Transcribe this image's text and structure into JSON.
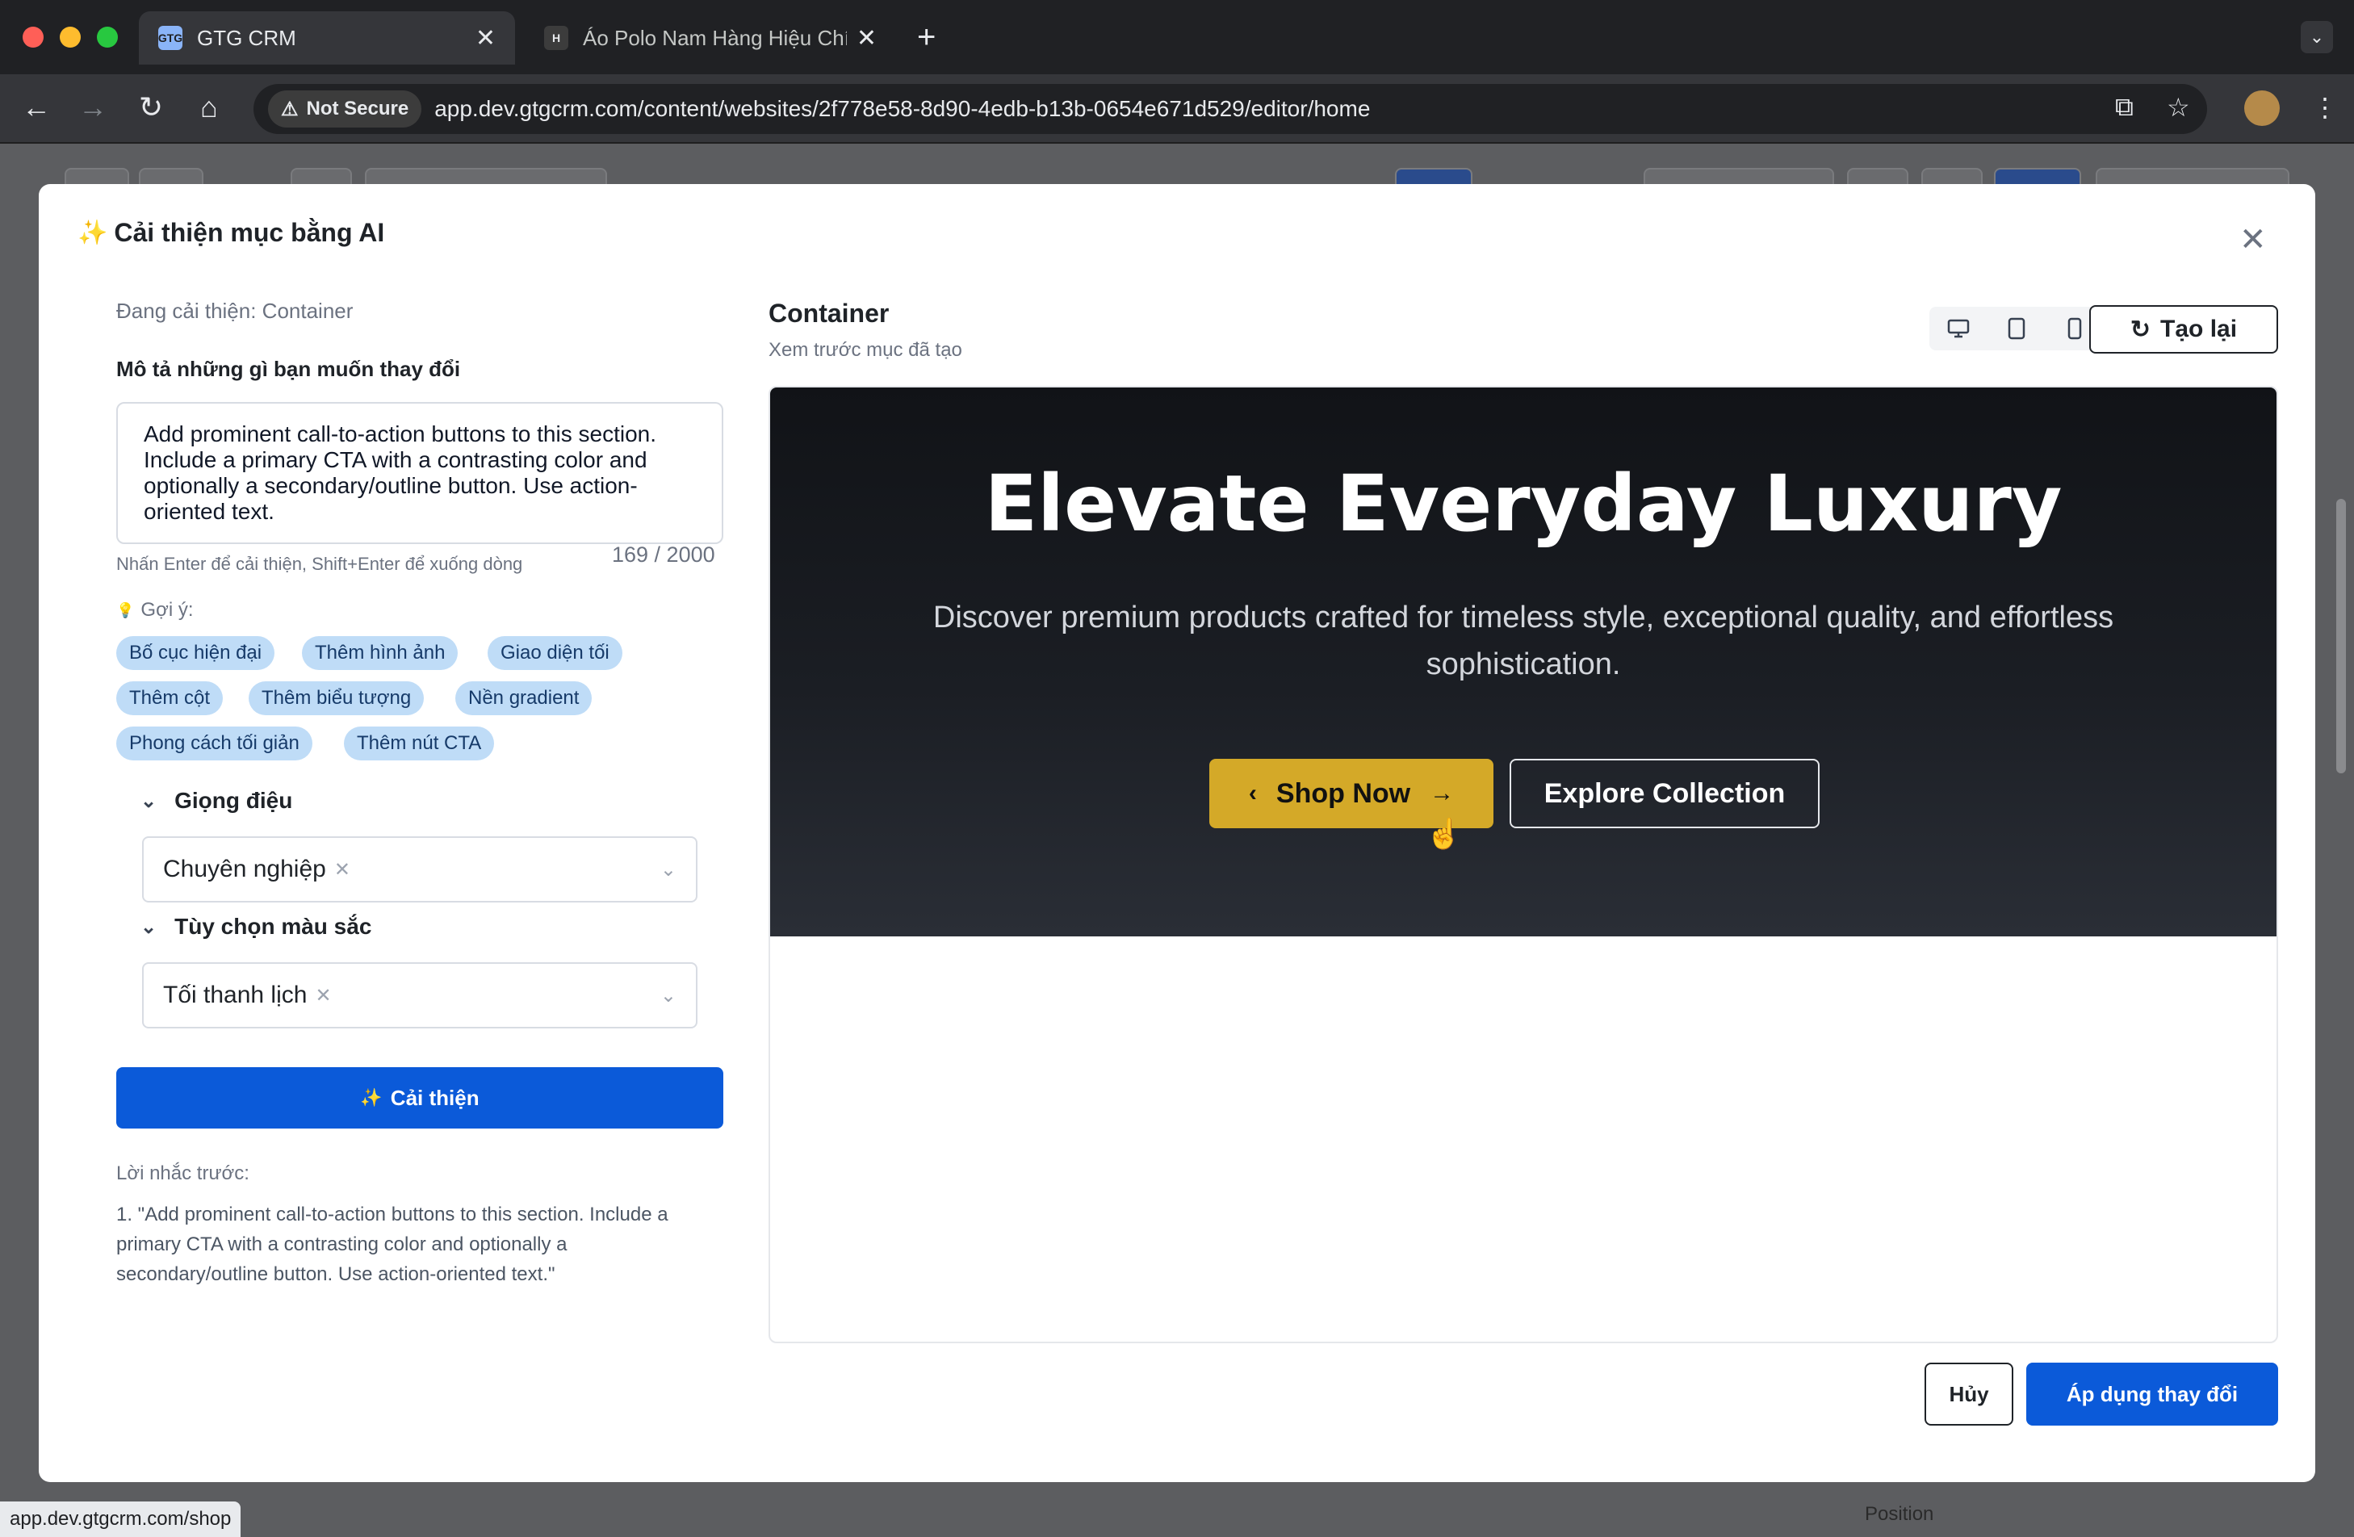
{
  "browser": {
    "tabs": [
      {
        "title": "GTG CRM",
        "favicon": "GTG"
      },
      {
        "title": "Áo Polo Nam Hàng Hiệu Chín",
        "favicon": "H"
      }
    ],
    "tab_close": "✕",
    "new_tab": "+",
    "security_label": "Not Secure",
    "url": "app.dev.gtgcrm.com/content/websites/2f778e58-8d90-4edb-b13b-0654e671d529/editor/home",
    "status_url": "app.dev.gtgcrm.com/shop"
  },
  "background": {
    "position_label": "Position"
  },
  "modal": {
    "title": "Cải thiện mục bằng AI",
    "close_icon": "close-icon",
    "editing_label": "Đang cải thiện: Container",
    "describe_label": "Mô tả những gì bạn muốn thay đổi",
    "prompt_value": "Add prominent call-to-action buttons to this section. Include a primary CTA with a contrasting color and optionally a secondary/outline button. Use action-oriented text.",
    "prompt_hint": "Nhấn Enter để cải thiện, Shift+Enter để xuống dòng",
    "prompt_count": "169 / 2000",
    "suggestions_label": "Gợi ý:",
    "suggestions": [
      "Bố cục hiện đại",
      "Thêm hình ảnh",
      "Giao diện tối",
      "Thêm cột",
      "Thêm biểu tượng",
      "Nền gradient",
      "Phong cách tối giản",
      "Thêm nút CTA"
    ],
    "tone": {
      "label": "Giọng điệu",
      "selected": "Chuyên nghiệp"
    },
    "color": {
      "label": "Tùy chọn màu sắc",
      "selected": "Tối thanh lịch"
    },
    "improve_button": "Cải thiện",
    "previous_label": "Lời nhắc trước:",
    "previous_prompts": [
      "1. \"Add prominent call-to-action buttons to this section. Include a primary CTA with a contrasting color and optionally a secondary/outline button. Use action-oriented text.\""
    ],
    "preview": {
      "title": "Container",
      "subtitle": "Xem trước mục đã tạo",
      "regenerate": "Tạo lại",
      "hero_title": "Elevate Everyday Luxury",
      "hero_subtitle": "Discover premium products crafted for timeless style, exceptional quality, and effortless sophistication.",
      "primary_cta": "Shop Now",
      "secondary_cta": "Explore Collection",
      "colors": {
        "hero_bg": "#111317",
        "cta_gold": "#d4a928",
        "accent_blue": "#0b5ad9"
      }
    },
    "cancel_button": "Hủy",
    "apply_button": "Áp dụng thay đổi"
  }
}
